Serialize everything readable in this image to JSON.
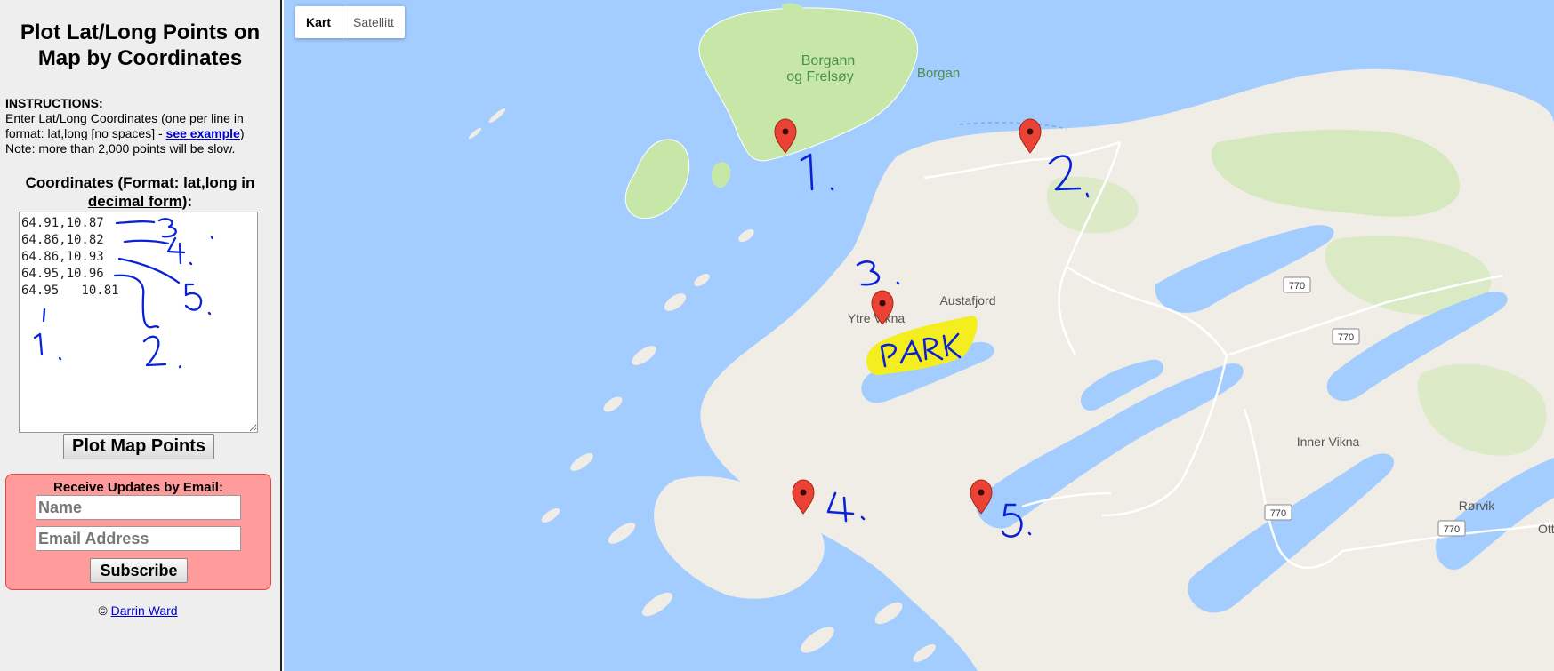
{
  "sidebar": {
    "title": "Plot Lat/Long Points on Map by Coordinates",
    "instructions_heading": "INSTRUCTIONS:",
    "instructions_text": "Enter Lat/Long Coordinates (one per line in format: lat,long [no spaces] - ",
    "example_link": "see example",
    "instructions_close": ")",
    "note": "Note: more than 2,000 points will be slow.",
    "coord_heading_a": "Coordinates (Format: lat,long in ",
    "coord_heading_u": "decimal form",
    "coord_heading_b": "):",
    "coordinates": "64.91,10.87\n64.86,10.82\n64.86,10.93\n64.95,10.96\n64.95   10.81",
    "plot_button": "Plot Map Points",
    "email_title": "Receive Updates by Email:",
    "name_placeholder": "Name",
    "email_placeholder": "Email Address",
    "subscribe_button": "Subscribe",
    "credit_prefix": "© ",
    "credit_link": "Darrin Ward"
  },
  "map": {
    "type_controls": [
      "Kart",
      "Satellitt"
    ],
    "selected_type": "Kart",
    "place_labels": [
      "Borgann og Frelsøy",
      "Borgan",
      "Austafjord",
      "Ytre Vikna",
      "Inner Vikna",
      "Rørvik",
      "Ott"
    ],
    "road_shields": [
      "770",
      "770",
      "770",
      "770"
    ],
    "marker_count": 5,
    "annotations": [
      "1.",
      "2.",
      "3.",
      "4.",
      "5.",
      "PARK"
    ],
    "colors": {
      "water": "#a3ccff",
      "land": "#f0ede6",
      "vegetation": "#c7e7a9",
      "marker": "#ea4335",
      "ink": "#0a22d6",
      "highlight": "#f5ee1e"
    }
  }
}
